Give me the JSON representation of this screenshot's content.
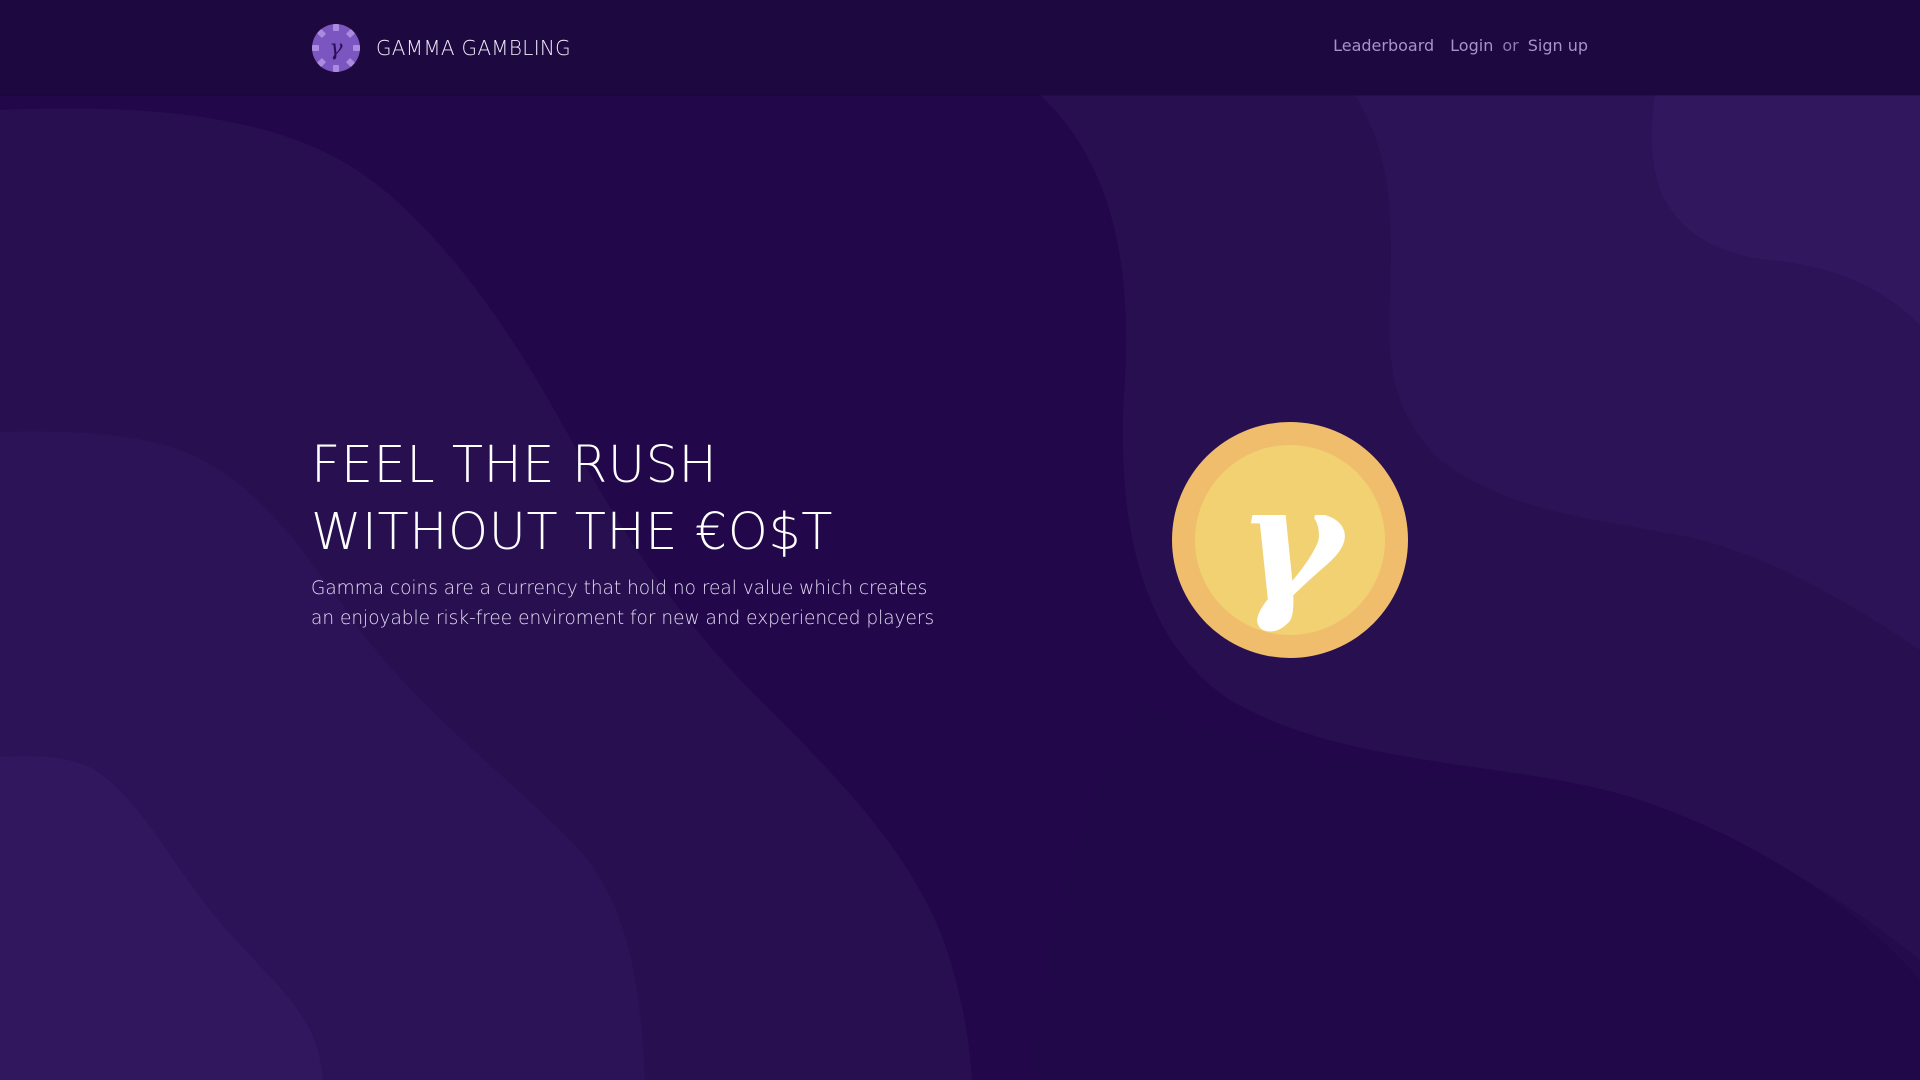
{
  "brand": {
    "name": "GAMMA GAMBLING",
    "logo_icon": "gamma-chip-icon",
    "logo_glyph": "γ"
  },
  "nav": {
    "leaderboard": "Leaderboard",
    "login": "Login",
    "separator": "or",
    "signup": "Sign up"
  },
  "hero": {
    "title_line1": "FEEL THE RUSH",
    "title_line2": "WITHOUT THE €O$T",
    "subtitle": "Gamma coins are a currency that hold no real value which creates an enjoyable risk-free enviroment for new and experienced players",
    "coin_icon": "gamma-coin-icon",
    "coin_glyph": "γ"
  },
  "colors": {
    "background": "#22084a",
    "navbar": "#1e0840",
    "coin_outer": "#f0bd6c",
    "coin_inner": "#f1d172",
    "logo_chip": "#7b55c0"
  }
}
